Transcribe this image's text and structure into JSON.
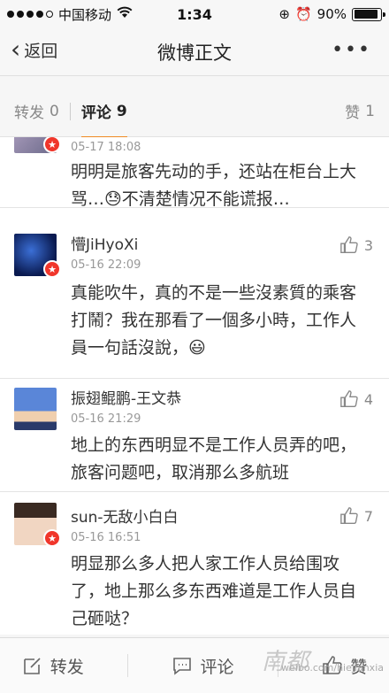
{
  "statusbar": {
    "carrier": "中国移动",
    "time": "1:34",
    "battery": "90%",
    "battery_level": 0.9
  },
  "nav": {
    "back_label": "返回",
    "title": "微博正文",
    "more": "•••"
  },
  "tabs": {
    "repost_label": "转发",
    "repost_count": "0",
    "comment_label": "评论",
    "comment_count": "9",
    "like_label": "赞",
    "like_count": "1"
  },
  "comments": [
    {
      "time": "05-17 18:08",
      "text": "明明是旅客先动的手，还站在柜台上大骂…😓不清楚情况不能谎报…"
    },
    {
      "name": "懵JiHyoXi",
      "time": "05-16 22:09",
      "text": "真能吹牛，真的不是一些沒素質的乘客打鬧？我在那看了一個多小時，工作人員一句話沒說，😃",
      "likes": "3"
    },
    {
      "name": "振翅鲲鹏-王文恭",
      "time": "05-16 21:29",
      "text": "地上的东西明显不是工作人员弄的吧，旅客问题吧，取消那么多航班",
      "likes": "4"
    },
    {
      "name": "sun-无敌小白白",
      "time": "05-16 16:51",
      "text": "明显那么多人把人家工作人员给围攻了，地上那么多东西难道是工作人员自己砸哒？",
      "likes": "7"
    }
  ],
  "toolbar": {
    "repost": "转发",
    "comment": "评论",
    "like": "赞"
  },
  "watermark": "weibo.com/hiejianxia",
  "watermark_logo": "南都"
}
